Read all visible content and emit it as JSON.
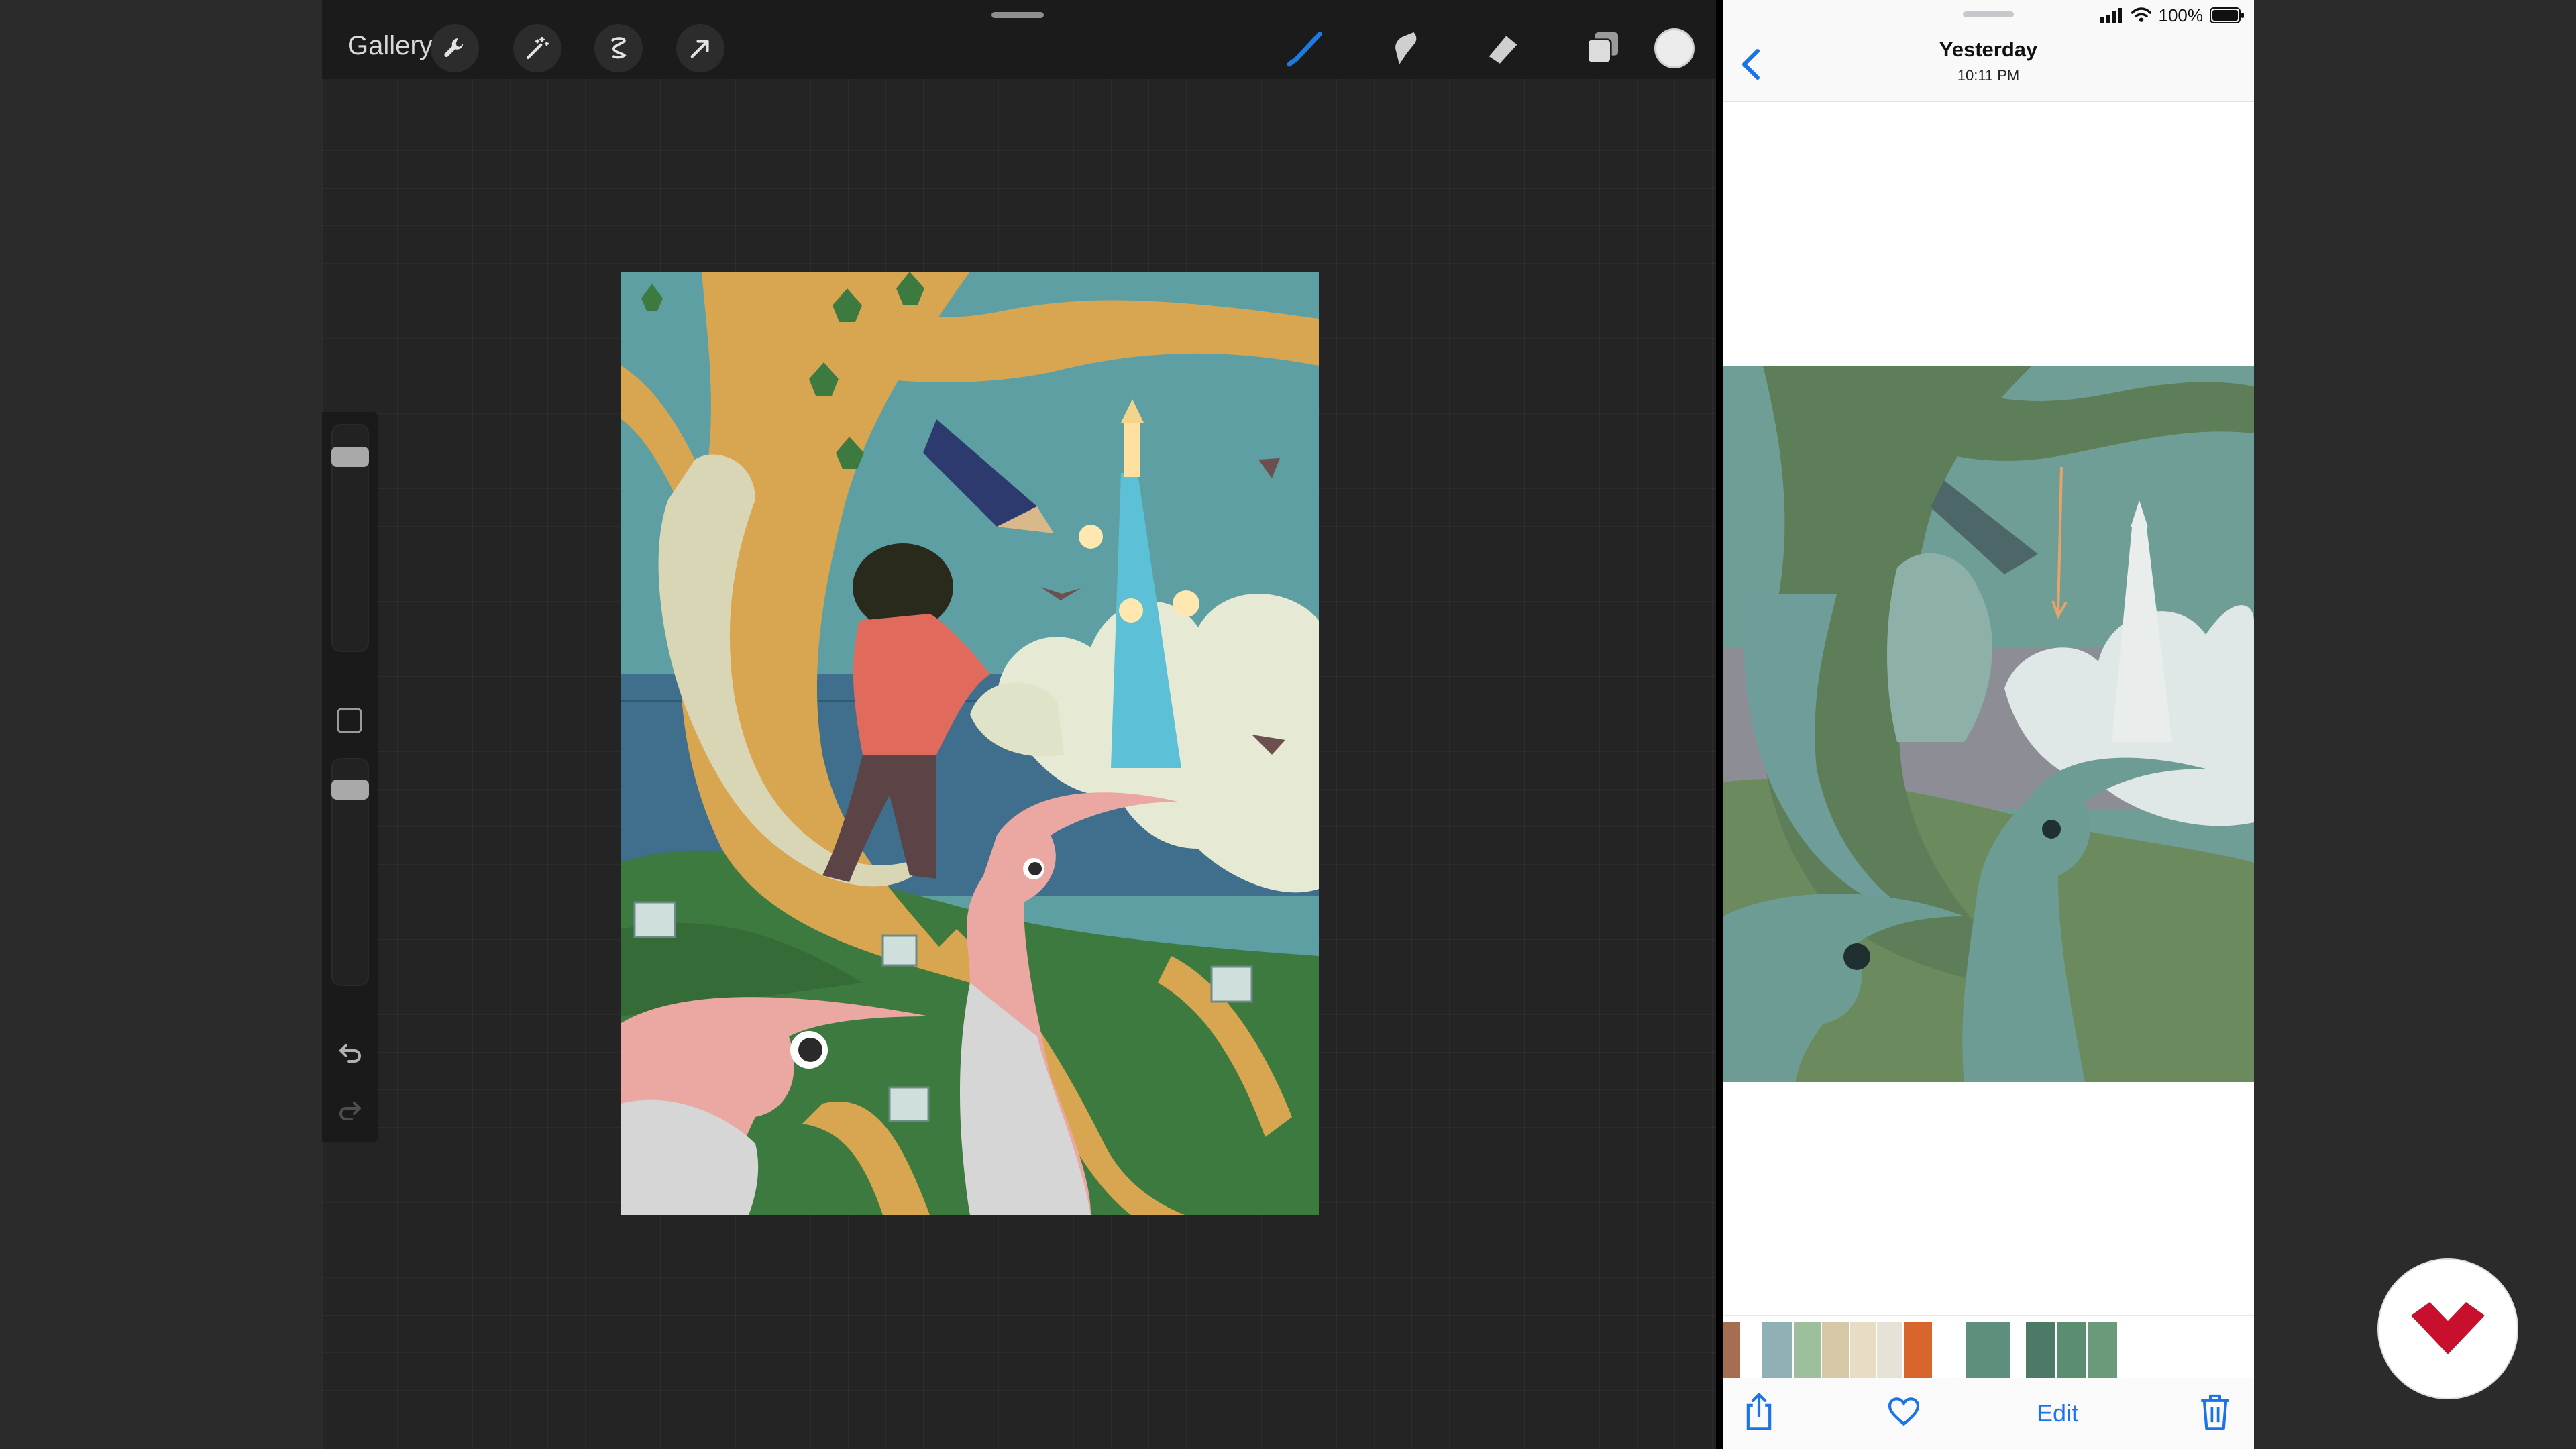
{
  "procreate": {
    "gallery_label": "Gallery",
    "tools_left": [
      "wrench-icon",
      "magic-wand-icon",
      "selection-icon",
      "transform-arrow-icon"
    ],
    "tools_right": [
      "brush-icon",
      "smudge-icon",
      "eraser-icon",
      "layers-icon"
    ],
    "active_tool": "brush",
    "current_color": "#ececec",
    "sidebar": {
      "brush_size_level": 0.85,
      "opacity_level": 0.9
    },
    "colors": {
      "toolbar_bg": "#1b1b1b",
      "workspace_bg": "#242424",
      "accent_blue": "#1f7ae0"
    }
  },
  "photos": {
    "status": {
      "battery": "100%"
    },
    "header": {
      "title": "Yesterday",
      "subtitle": "10:11 PM"
    },
    "toolbar": {
      "edit_label": "Edit",
      "icons": [
        "share-icon",
        "heart-icon",
        "trash-icon"
      ]
    },
    "accent_color": "#1a73e8"
  },
  "logo": {
    "name": "brand-logo",
    "color": "#c8102e"
  }
}
